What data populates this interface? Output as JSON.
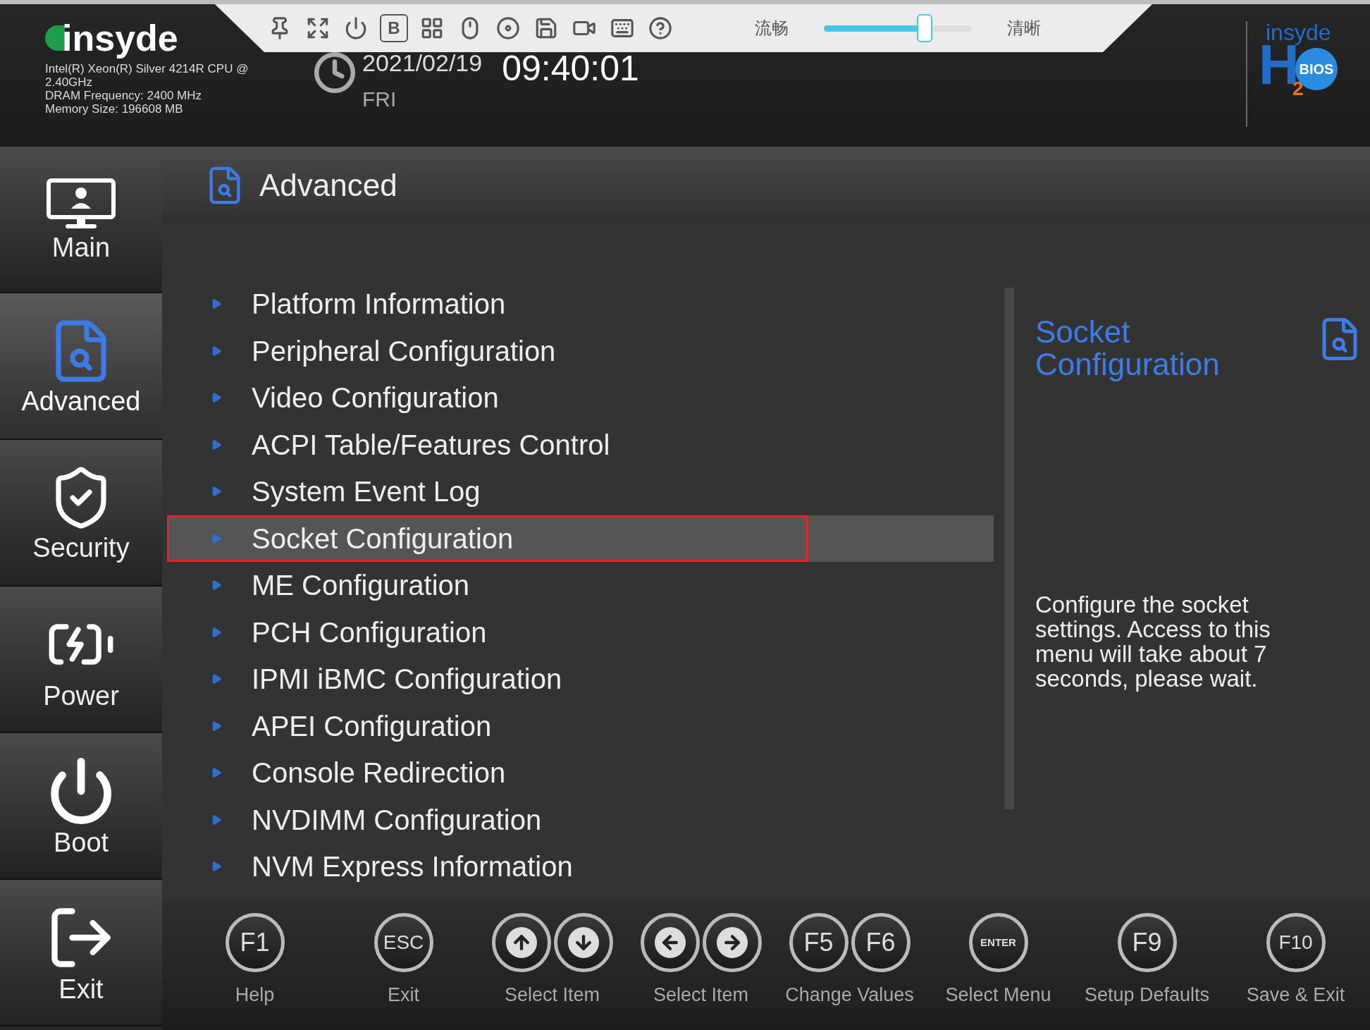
{
  "header": {
    "logo": "insyde",
    "cpu_info": [
      "Intel(R) Xeon(R) Silver 4214R CPU @",
      "2.40GHz",
      "DRAM Frequency: 2400 MHz",
      "Memory Size: 196608 MB"
    ],
    "date": "2021/02/19",
    "day": "FRI",
    "time": "09:40:01",
    "brand_logo": {
      "top": "insyde",
      "h": "H",
      "sub": "2",
      "badge": "BIOS"
    }
  },
  "toolbar": {
    "tools": [
      {
        "kind": "pin"
      },
      {
        "kind": "fullscreen"
      },
      {
        "kind": "power"
      },
      {
        "kind": "letter",
        "label": "B"
      },
      {
        "kind": "layout"
      },
      {
        "kind": "mouse"
      },
      {
        "kind": "disc"
      },
      {
        "kind": "save"
      },
      {
        "kind": "video"
      },
      {
        "kind": "keyboard"
      },
      {
        "kind": "help"
      }
    ],
    "quality": {
      "left_label": "流畅",
      "right_label": "清晰",
      "level": 0.68
    }
  },
  "sidebar": {
    "items": [
      {
        "kind": "main",
        "label": "Main",
        "selected": false
      },
      {
        "kind": "advanced",
        "label": "Advanced",
        "selected": true
      },
      {
        "kind": "security",
        "label": "Security",
        "selected": false
      },
      {
        "kind": "power",
        "label": "Power",
        "selected": false
      },
      {
        "kind": "boot",
        "label": "Boot",
        "selected": false
      },
      {
        "kind": "exit",
        "label": "Exit",
        "selected": false
      }
    ]
  },
  "page": {
    "title": "Advanced"
  },
  "menu": {
    "items": [
      {
        "label": "Platform Information",
        "selected": false
      },
      {
        "label": "Peripheral Configuration",
        "selected": false
      },
      {
        "label": "Video Configuration",
        "selected": false
      },
      {
        "label": "ACPI Table/Features Control",
        "selected": false
      },
      {
        "label": "System Event Log",
        "selected": false
      },
      {
        "label": "Socket Configuration",
        "selected": true
      },
      {
        "label": "ME Configuration",
        "selected": false
      },
      {
        "label": "PCH Configuration",
        "selected": false
      },
      {
        "label": "IPMI iBMC Configuration",
        "selected": false
      },
      {
        "label": "APEI Configuration",
        "selected": false
      },
      {
        "label": "Console Redirection",
        "selected": false
      },
      {
        "label": "NVDIMM Configuration",
        "selected": false
      },
      {
        "label": "NVM Express Information",
        "selected": false
      }
    ]
  },
  "help_panel": {
    "title": "Socket Configuration",
    "description": "Configure the socket settings. Access to this menu will take about 7 seconds, please wait."
  },
  "key_bar": [
    {
      "keys": [
        {
          "kind": "text",
          "label": "F1"
        }
      ],
      "label": "Help"
    },
    {
      "keys": [
        {
          "kind": "text",
          "label": "ESC"
        }
      ],
      "label": "Exit"
    },
    {
      "keys": [
        {
          "kind": "up"
        },
        {
          "kind": "down"
        }
      ],
      "label": "Select Item"
    },
    {
      "keys": [
        {
          "kind": "left"
        },
        {
          "kind": "right"
        }
      ],
      "label": "Select Item"
    },
    {
      "keys": [
        {
          "kind": "text",
          "label": "F5"
        },
        {
          "kind": "text",
          "label": "F6"
        }
      ],
      "label": "Change Values"
    },
    {
      "keys": [
        {
          "kind": "text",
          "label": "ENTER"
        }
      ],
      "label": "Select Menu"
    },
    {
      "keys": [
        {
          "kind": "text",
          "label": "F9"
        }
      ],
      "label": "Setup Defaults"
    },
    {
      "keys": [
        {
          "kind": "text",
          "label": "F10"
        }
      ],
      "label": "Save & Exit"
    }
  ]
}
